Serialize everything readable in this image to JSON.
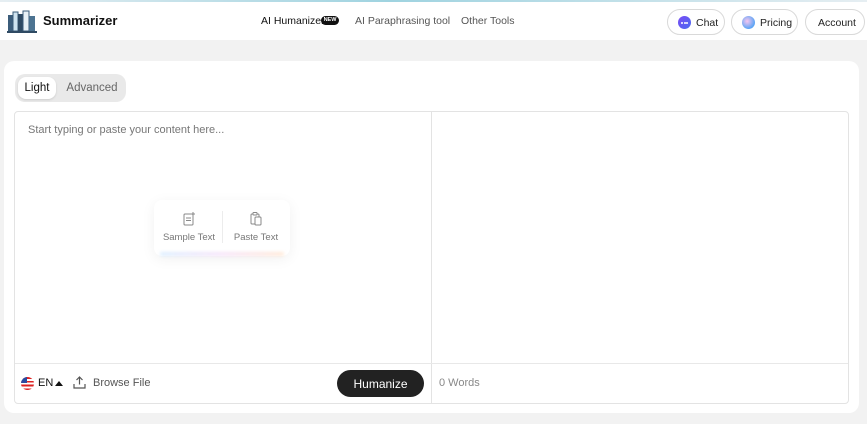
{
  "header": {
    "brand": "Summarizer",
    "nav": [
      {
        "label": "AI Humanizer",
        "badge": "NEW",
        "active": true
      },
      {
        "label": "AI Paraphrasing tool"
      },
      {
        "label": "Other Tools"
      }
    ],
    "buttons": {
      "chat": "Chat",
      "pricing": "Pricing",
      "account": "Account"
    }
  },
  "mode_tabs": [
    {
      "label": "Light",
      "selected": true
    },
    {
      "label": "Advanced",
      "selected": false
    }
  ],
  "editor": {
    "placeholder": "Start typing or paste your content here...",
    "value": "",
    "actions": {
      "sample": "Sample Text",
      "paste": "Paste Text"
    }
  },
  "footer": {
    "language": "EN",
    "browse": "Browse File",
    "humanize": "Humanize",
    "word_count": "0 Words"
  },
  "colors": {
    "primary_button": "#222222",
    "chat_icon": "#6a55f3",
    "accent_line": "#9fd3e0"
  }
}
